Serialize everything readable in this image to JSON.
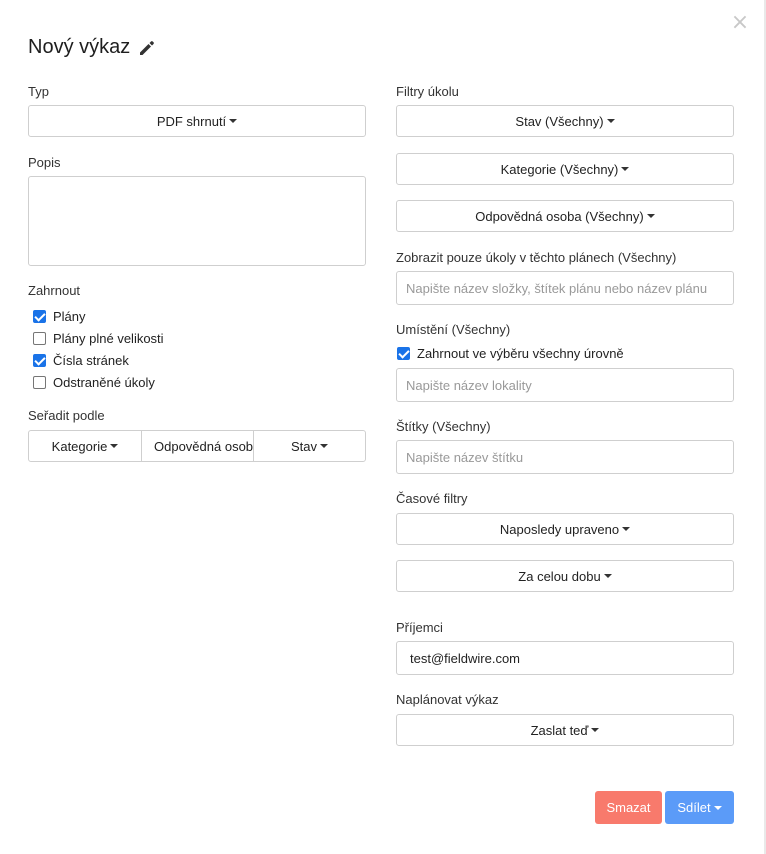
{
  "dialog": {
    "title": "Nový výkaz",
    "close_icon": "close-icon",
    "edit_icon": "pencil-icon"
  },
  "left": {
    "type_label": "Typ",
    "type_value": "PDF shrnutí",
    "description_label": "Popis",
    "description_value": "",
    "include_label": "Zahrnout",
    "include_options": [
      {
        "label": "Plány",
        "checked": true
      },
      {
        "label": "Plány plné velikosti",
        "checked": false
      },
      {
        "label": "Čísla stránek",
        "checked": true
      },
      {
        "label": "Odstraněné úkoly",
        "checked": false
      }
    ],
    "sort_label": "Seřadit podle",
    "sort_buttons": [
      "Kategorie",
      "Odpovědná osoba",
      "Stav"
    ]
  },
  "right": {
    "task_filters_label": "Filtry úkolu",
    "status_filter": "Stav (Všechny)",
    "category_filter": "Kategorie (Všechny)",
    "assignee_filter": "Odpovědná osoba (Všechny)",
    "plans_label": "Zobrazit pouze úkoly v těchto plánech (Všechny)",
    "plans_placeholder": "Napište název složky, štítek plánu nebo název plánu",
    "location_label": "Umístění (Všechny)",
    "location_checkbox_label": "Zahrnout ve výběru všechny úrovně",
    "location_checkbox_checked": true,
    "location_placeholder": "Napište název lokality",
    "tags_label": "Štítky (Všechny)",
    "tags_placeholder": "Napište název štítku",
    "time_filters_label": "Časové filtry",
    "last_modified": "Naposledy upraveno",
    "time_range": "Za celou dobu",
    "recipients_label": "Příjemci",
    "recipients_value": "test@fieldwire.com",
    "schedule_label": "Naplánovat výkaz",
    "schedule_value": "Zaslat teď"
  },
  "footer": {
    "delete_label": "Smazat",
    "share_label": "Sdílet",
    "colors": {
      "delete": "#f87a6c",
      "share": "#5b9bf8"
    }
  }
}
